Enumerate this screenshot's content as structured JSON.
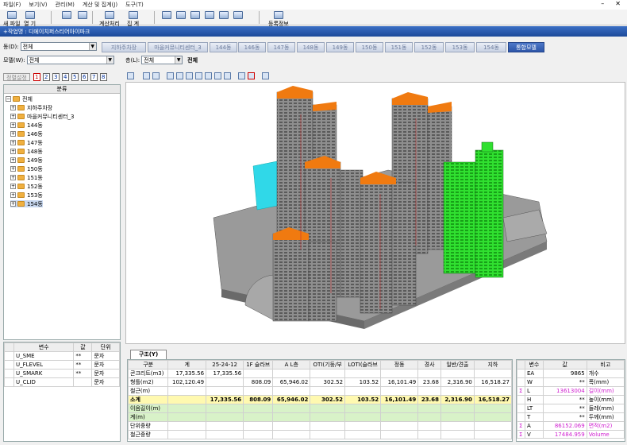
{
  "menu": [
    "파일(F)",
    "보기(V)",
    "관리(M)",
    "계산 및 집계(J)",
    "도구(T)"
  ],
  "window_controls": [
    "–",
    "✕"
  ],
  "toolbar": {
    "buttons": [
      {
        "label": "새 파일",
        "icon": "new-file-icon"
      },
      {
        "label": "열 기",
        "icon": "open-icon"
      },
      {
        "label": "",
        "icon": "search-icon"
      },
      {
        "label": "",
        "icon": "search-alt-icon"
      },
      {
        "label": "계산처리",
        "icon": "calc-icon"
      },
      {
        "label": "집 계",
        "icon": "sum-icon"
      },
      {
        "label": "",
        "icon": "grid-icon"
      },
      {
        "label": "",
        "icon": "grid-edit-icon"
      },
      {
        "label": "",
        "icon": "grid-list-icon"
      },
      {
        "label": "",
        "icon": "grid-check-icon"
      },
      {
        "label": "",
        "icon": "grid-pencil-icon"
      },
      {
        "label": "",
        "icon": "grid-dots-icon"
      },
      {
        "label": "등록정보",
        "icon": "properties-icon"
      }
    ]
  },
  "title": "+작업명 : 디에이치퍼스티어아이파크",
  "dong": {
    "label": "동(D):",
    "value": "전체"
  },
  "tabs": [
    {
      "label": "지하주차장",
      "active": false
    },
    {
      "label": "마을커뮤니티센터_3",
      "active": false
    },
    {
      "label": "144동",
      "active": false
    },
    {
      "label": "146동",
      "active": false
    },
    {
      "label": "147동",
      "active": false
    },
    {
      "label": "148동",
      "active": false
    },
    {
      "label": "149동",
      "active": false
    },
    {
      "label": "150동",
      "active": false
    },
    {
      "label": "151동",
      "active": false
    },
    {
      "label": "152동",
      "active": false
    },
    {
      "label": "153동",
      "active": false
    },
    {
      "label": "154동",
      "active": false
    },
    {
      "label": "통합모델",
      "active": true
    }
  ],
  "model": {
    "label": "모델(W):",
    "value": "전체"
  },
  "floor": {
    "label": "층(L):",
    "value": "전체",
    "text": "전체"
  },
  "left_toolbar": {
    "align_label": "정렬설정",
    "numbers": [
      "1",
      "2",
      "3",
      "4",
      "5",
      "6",
      "7",
      "8"
    ]
  },
  "tree": {
    "header": "분류",
    "root": "전체",
    "items": [
      "지하주차장",
      "마을커뮤니티센터_3",
      "144동",
      "146동",
      "147동",
      "148동",
      "149동",
      "150동",
      "151동",
      "152동",
      "153동",
      "154동"
    ],
    "selected": "154동"
  },
  "var_table": {
    "headers": [
      "변수",
      "값",
      "단위"
    ],
    "rows": [
      [
        "U_SME",
        "**",
        "문자"
      ],
      [
        "U_FLEVEL",
        "**",
        "문자"
      ],
      [
        "U_SMARK",
        "**",
        "문자"
      ],
      [
        "U_CLID",
        "",
        "문자"
      ]
    ]
  },
  "bottom_tab": "구조(Y)",
  "struct_table": {
    "headers": [
      "구분",
      "계",
      "25-24-12",
      "1F 슬라브",
      "A L층",
      "OTI(기둥/부",
      "LOTI(슬라브",
      "정동",
      "경사",
      "일반/견출",
      "지하"
    ],
    "rows": [
      [
        "콘크리트(m3)",
        "17,335.56",
        "17,335.56",
        "",
        "",
        "",
        "",
        "",
        "",
        "",
        ""
      ],
      [
        "형틀(m2)",
        "102,120.49",
        "",
        "808.09",
        "65,946.02",
        "302.52",
        "103.52",
        "16,101.49",
        "23.68",
        "2,316.90",
        "16,518.27"
      ],
      [
        "철근(m)",
        "",
        "",
        "",
        "",
        "",
        "",
        "",
        "",
        "",
        ""
      ],
      [
        "소계",
        "",
        "17,335.56",
        "808.09",
        "65,946.02",
        "302.52",
        "103.52",
        "16,101.49",
        "23.68",
        "2,316.90",
        "16,518.27"
      ],
      [
        "이음길이(m)",
        "",
        "",
        "",
        "",
        "",
        "",
        "",
        "",
        "",
        ""
      ],
      [
        "계(m)",
        "",
        "",
        "",
        "",
        "",
        "",
        "",
        "",
        "",
        ""
      ],
      [
        "단위중량",
        "",
        "",
        "",
        "",
        "",
        "",
        "",
        "",
        "",
        ""
      ],
      [
        "철근중량",
        "",
        "",
        "",
        "",
        "",
        "",
        "",
        "",
        "",
        ""
      ]
    ]
  },
  "right_table": {
    "headers": [
      "변수",
      "값",
      "비고"
    ],
    "rows": [
      {
        "sym": "",
        "var": "EA",
        "val": "9865",
        "note": "개수"
      },
      {
        "sym": "",
        "var": "W",
        "val": "**",
        "note": "폭(mm)"
      },
      {
        "sym": "Σ",
        "var": "L",
        "val": "13613004",
        "note": "길이(mm)"
      },
      {
        "sym": "",
        "var": "H",
        "val": "**",
        "note": "높이(mm)"
      },
      {
        "sym": "",
        "var": "LT",
        "val": "**",
        "note": "둘레(mm)"
      },
      {
        "sym": "",
        "var": "T",
        "val": "**",
        "note": "두께(mm)"
      },
      {
        "sym": "Σ",
        "var": "A",
        "val": "86152.069",
        "note": "면적(m2)"
      },
      {
        "sym": "Σ",
        "var": "V",
        "val": "17484.959",
        "note": "Volume"
      }
    ]
  },
  "colors": {
    "accent": "#2c55a8",
    "orange": "#f07a10",
    "green": "#20e020",
    "cyan": "#30d8e8",
    "building": "#8a8a8a"
  }
}
